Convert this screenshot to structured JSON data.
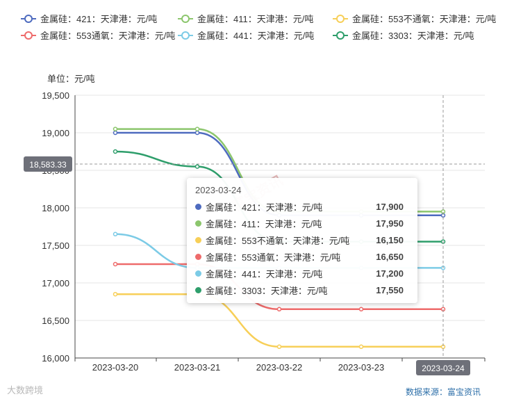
{
  "chart_data": {
    "type": "line",
    "x": [
      "2023-03-20",
      "2023-03-21",
      "2023-03-22",
      "2023-03-23",
      "2023-03-24"
    ],
    "ylim": [
      16000,
      19500
    ],
    "yticks": [
      16000,
      16500,
      17000,
      17500,
      18000,
      18500,
      19000,
      19500
    ],
    "ytick_labels": [
      "16,000",
      "16,500",
      "17,000",
      "17,500",
      "18,000",
      "18,500",
      "19,000",
      "19,500"
    ],
    "unit_label": "单位：元/吨",
    "crosshair_value": "18,583.33",
    "crosshair_y": 18583.33,
    "grid": true,
    "legend_position": "top",
    "series": [
      {
        "name": "金属硅：421：天津港：元/吨",
        "color": "#4e6bbf",
        "values": [
          19000,
          19000,
          17900,
          17900,
          17900
        ]
      },
      {
        "name": "金属硅：411：天津港：元/吨",
        "color": "#8cc66d",
        "values": [
          19050,
          19050,
          17950,
          17950,
          17950
        ]
      },
      {
        "name": "金属硅：553不通氧：天津港：元/吨",
        "color": "#f7cf58",
        "values": [
          16850,
          16850,
          16150,
          16150,
          16150
        ]
      },
      {
        "name": "金属硅：553通氧：天津港：元/吨",
        "color": "#ee6b6b",
        "values": [
          17250,
          17250,
          16650,
          16650,
          16650
        ]
      },
      {
        "name": "金属硅：441：天津港：元/吨",
        "color": "#7ccbe6",
        "values": [
          17650,
          17200,
          17200,
          17200,
          17200
        ]
      },
      {
        "name": "金属硅：3303：天津港：元/吨",
        "color": "#2e9e6b",
        "values": [
          18750,
          18550,
          17550,
          17550,
          17550
        ]
      }
    ]
  },
  "tooltip": {
    "date": "2023-03-24",
    "rows": [
      {
        "name": "金属硅：421：天津港：元/吨",
        "value": "17,900",
        "color": "#4e6bbf"
      },
      {
        "name": "金属硅：411：天津港：元/吨",
        "value": "17,950",
        "color": "#8cc66d"
      },
      {
        "name": "金属硅：553不通氧：天津港：元/吨",
        "value": "16,150",
        "color": "#f7cf58"
      },
      {
        "name": "金属硅：553通氧：天津港：元/吨",
        "value": "16,650",
        "color": "#ee6b6b"
      },
      {
        "name": "金属硅：441：天津港：元/吨",
        "value": "17,200",
        "color": "#7ccbe6"
      },
      {
        "name": "金属硅：3303：天津港：元/吨",
        "value": "17,550",
        "color": "#2e9e6b"
      }
    ]
  },
  "footer": {
    "source": "数据来源：富宝资讯",
    "brand": "大数跨境",
    "watermark": "富宝资讯"
  }
}
